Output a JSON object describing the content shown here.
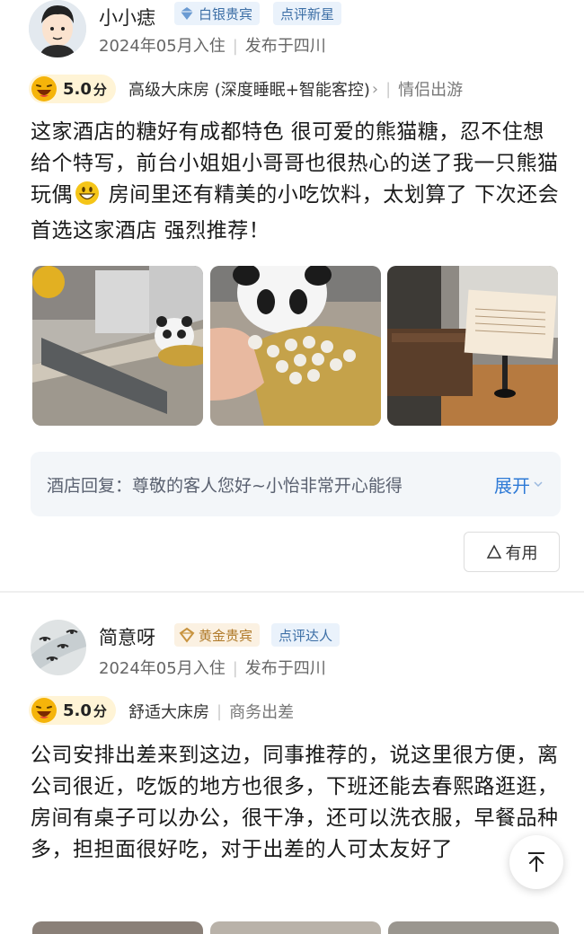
{
  "reviews": [
    {
      "username": "小小痣",
      "member_badge": "白银贵宾",
      "tag_badge": "点评新星",
      "stay_date": "2024年05月入住",
      "location": "发布于四川",
      "score": "5.0",
      "score_unit": "分",
      "room_type": "高级大床房 (深度睡眠+智能客控)",
      "trip_type": "情侣出游",
      "text_parts": [
        "这家酒店的糖好有成都特色 很可爱的熊猫糖，忍不住想给个特写，前台小姐姐小哥哥也很热心的送了我一只熊猫玩偶",
        " 房间里还有精美的小吃饮料，太划算了 下次还会首选这家酒店 强烈推荐！"
      ],
      "reply_label": "酒店回复：",
      "reply_text": "尊敬的客人您好~小怡非常开心能得",
      "reply_expand": "展开",
      "useful_label": "有用"
    },
    {
      "username": "简意呀",
      "member_badge": "黄金贵宾",
      "tag_badge": "点评达人",
      "stay_date": "2024年05月入住",
      "location": "发布于四川",
      "score": "5.0",
      "score_unit": "分",
      "room_type": "舒适大床房",
      "trip_type": "商务出差",
      "text": "公司安排出差来到这边，同事推荐的，说这里很方便，离公司很近，吃饭的地方也很多，下班还能去春熙路逛逛，房间有桌子可以办公，很干净，还可以洗衣服，早餐品种多，担担面很好吃，对于出差的人可太友好了"
    }
  ],
  "colors": {
    "link_blue": "#2e7ad6",
    "silver_badge_bg": "#eaf2fb",
    "gold_badge_bg": "#fbf1e2",
    "score_bg": "#fff4d6"
  }
}
